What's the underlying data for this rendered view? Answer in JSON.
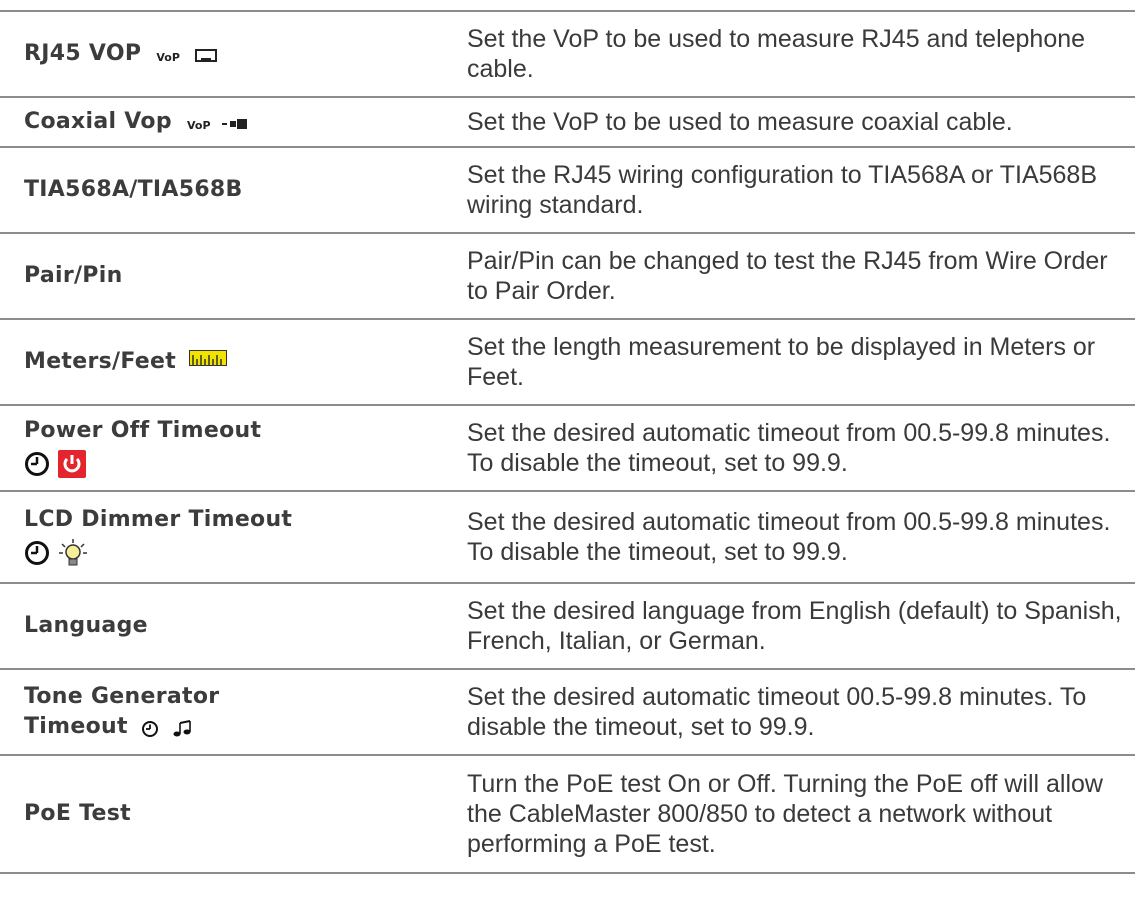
{
  "rows": [
    {
      "label": "RJ45 VOP",
      "icon_text": "VoP",
      "icons": [
        "vop-icon",
        "rj45-jack-icon"
      ],
      "desc": "Set the VoP to be used to measure RJ45 and telephone cable."
    },
    {
      "label": "Coaxial Vop",
      "icon_text": "VoP",
      "icons": [
        "vop-icon",
        "coax-connector-icon"
      ],
      "desc": "Set the VoP to be used to measure coaxial cable."
    },
    {
      "label": "TIA568A/TIA568B",
      "desc": "Set the RJ45 wiring configuration to TIA568A or TIA568B wiring standard."
    },
    {
      "label": "Pair/Pin",
      "desc": "Pair/Pin can be changed to test the RJ45 from Wire Order to Pair Order."
    },
    {
      "label": "Meters/Feet",
      "icons": [
        "ruler-icon"
      ],
      "desc": "Set the length measurement to be displayed in Meters or Feet."
    },
    {
      "label": "Power Off Timeout",
      "icons": [
        "clock-icon",
        "power-icon"
      ],
      "desc": "Set the desired automatic timeout from 00.5-99.8 minutes. To disable the timeout, set to 99.9."
    },
    {
      "label": "LCD Dimmer Timeout",
      "icons": [
        "clock-icon",
        "lightbulb-icon"
      ],
      "desc": "Set the desired automatic timeout from 00.5-99.8 minutes. To disable the timeout, set to 99.9."
    },
    {
      "label": "Language",
      "desc": "Set the desired language from English (default) to Spanish, French, Italian, or German."
    },
    {
      "label_line1": "Tone Generator",
      "label_line2": "Timeout",
      "icons": [
        "clock-icon",
        "music-note-icon"
      ],
      "desc": "Set the desired automatic timeout 00.5-99.8 minutes. To disable the timeout, set to 99.9."
    },
    {
      "label": "PoE Test",
      "desc": "Turn the PoE test On or Off. Turning the PoE off will allow the CableMaster 800/850 to detect a network without performing a PoE test."
    }
  ],
  "colors": {
    "rule": "#8c8c8c",
    "text": "#3a3a3a",
    "power_red": "#e3262d",
    "ruler_yellow": "#f2e200"
  }
}
